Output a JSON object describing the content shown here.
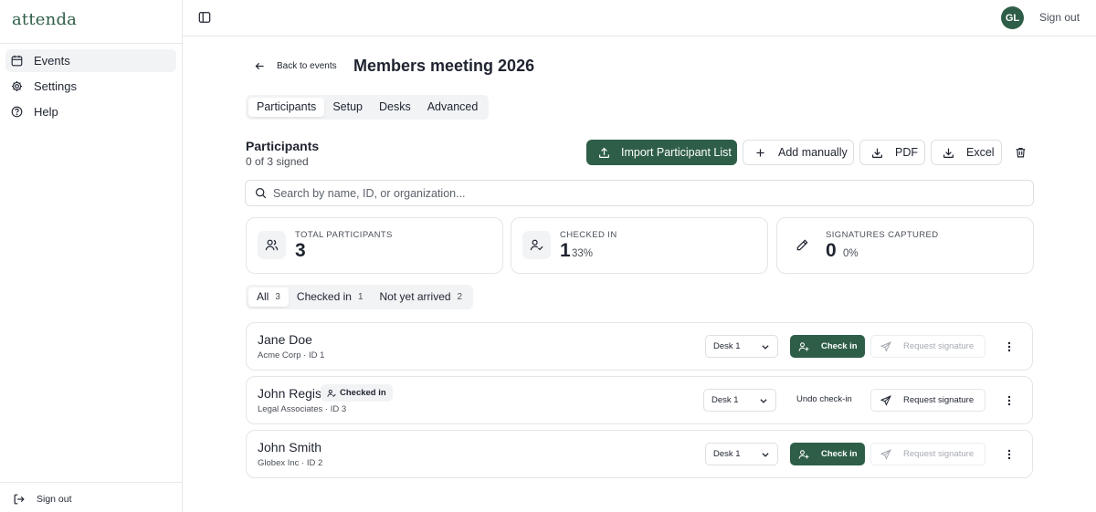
{
  "app": {
    "logo": "attenda",
    "user_initials": "GL",
    "sign_out": "Sign out"
  },
  "sidebar": {
    "items": [
      {
        "label": "Events",
        "icon": "calendar-icon",
        "active": true
      },
      {
        "label": "Settings",
        "icon": "gear-icon",
        "active": false
      },
      {
        "label": "Help",
        "icon": "help-circle-icon",
        "active": false
      }
    ],
    "sign_out": "Sign out"
  },
  "header": {
    "back_label": "Back to events",
    "title": "Members meeting 2026"
  },
  "tabs": [
    "Participants",
    "Setup",
    "Desks",
    "Advanced"
  ],
  "active_tab": "Participants",
  "participants": {
    "title": "Participants",
    "subtitle": "0 of 3 signed",
    "buttons": {
      "import": "Import Participant List",
      "add": "Add manually",
      "pdf": "PDF",
      "excel": "Excel"
    },
    "search_placeholder": "Search by name, ID, or organization...",
    "stats": [
      {
        "label": "TOTAL PARTICIPANTS",
        "value": "3",
        "percent": "",
        "icon": "users-icon"
      },
      {
        "label": "CHECKED IN",
        "value": "1",
        "percent": "33%",
        "icon": "user-check-icon"
      },
      {
        "label": "SIGNATURES CAPTURED",
        "value": "0",
        "percent": "0%",
        "icon": "pen-icon"
      }
    ],
    "filters": [
      {
        "label": "All",
        "count": "3",
        "active": true
      },
      {
        "label": "Checked in",
        "count": "1",
        "active": false
      },
      {
        "label": "Not yet arrived",
        "count": "2",
        "active": false
      }
    ],
    "list": [
      {
        "name": "Jane Doe",
        "meta": "Acme Corp · ID 1",
        "desk": "Desk 1",
        "checked_in": false,
        "action": "Check in",
        "request": "Request signature"
      },
      {
        "name": "John Regis",
        "meta": "Legal Associates · ID 3",
        "desk": "Desk 1",
        "checked_in": true,
        "badge": "Checked in",
        "action": "Undo check-in",
        "request": "Request signature"
      },
      {
        "name": "John Smith",
        "meta": "Globex Inc · ID 2",
        "desk": "Desk 1",
        "checked_in": false,
        "action": "Check in",
        "request": "Request signature"
      }
    ]
  },
  "colors": {
    "brand": "#2e5e48",
    "border": "#e3e5e8",
    "muted_bg": "#f1f3f5"
  }
}
